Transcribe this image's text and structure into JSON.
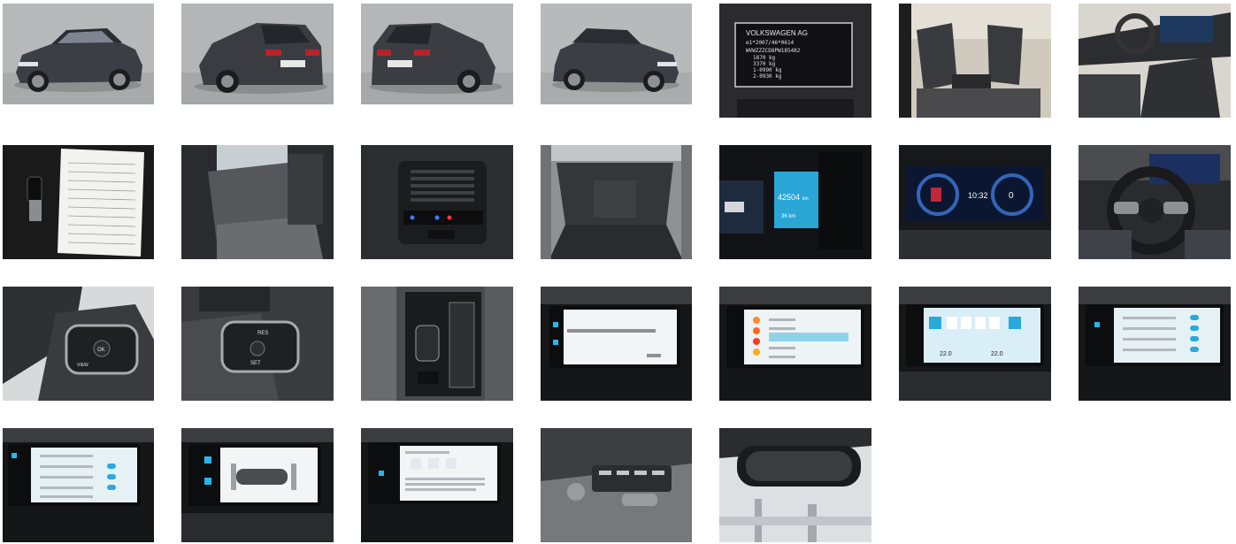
{
  "gallery": {
    "photos": [
      {
        "alt": "exterior-front-left"
      },
      {
        "alt": "exterior-rear-left"
      },
      {
        "alt": "exterior-rear-right"
      },
      {
        "alt": "exterior-front-right"
      },
      {
        "alt": "vin-plate"
      },
      {
        "alt": "front-seats"
      },
      {
        "alt": "dashboard-interior"
      },
      {
        "alt": "keys-and-documents"
      },
      {
        "alt": "rear-seats"
      },
      {
        "alt": "rear-air-vents"
      },
      {
        "alt": "trunk"
      },
      {
        "alt": "odometer-display"
      },
      {
        "alt": "digital-cockpit"
      },
      {
        "alt": "steering-wheel"
      },
      {
        "alt": "steering-wheel-left-buttons"
      },
      {
        "alt": "steering-wheel-right-buttons"
      },
      {
        "alt": "center-console"
      },
      {
        "alt": "infotainment-message"
      },
      {
        "alt": "infotainment-radio"
      },
      {
        "alt": "infotainment-climate"
      },
      {
        "alt": "infotainment-assist-settings"
      },
      {
        "alt": "infotainment-assist-toggles"
      },
      {
        "alt": "infotainment-parking-view"
      },
      {
        "alt": "infotainment-ecall"
      },
      {
        "alt": "door-seat-memory"
      },
      {
        "alt": "rear-view-mirror"
      }
    ]
  },
  "vin_plate": {
    "maker": "VOLKSWAGEN AG",
    "line1": "e1*2007/46*0614",
    "line2": "WVWZZZCD8PW185482",
    "line3": "1870 kg",
    "line4": "3370 kg",
    "line5": "1-0990 kg",
    "line6": "2-0930 kg"
  },
  "odometer": {
    "value": "42504",
    "unit": "km",
    "range": "36 km"
  },
  "cockpit": {
    "time": "10:32",
    "speed": "0"
  },
  "steering_buttons": {
    "ok": "OK",
    "view": "VIEW",
    "res": "RES",
    "set": "SET"
  },
  "climate": {
    "left_temp": "22.0",
    "right_temp": "22.0"
  }
}
